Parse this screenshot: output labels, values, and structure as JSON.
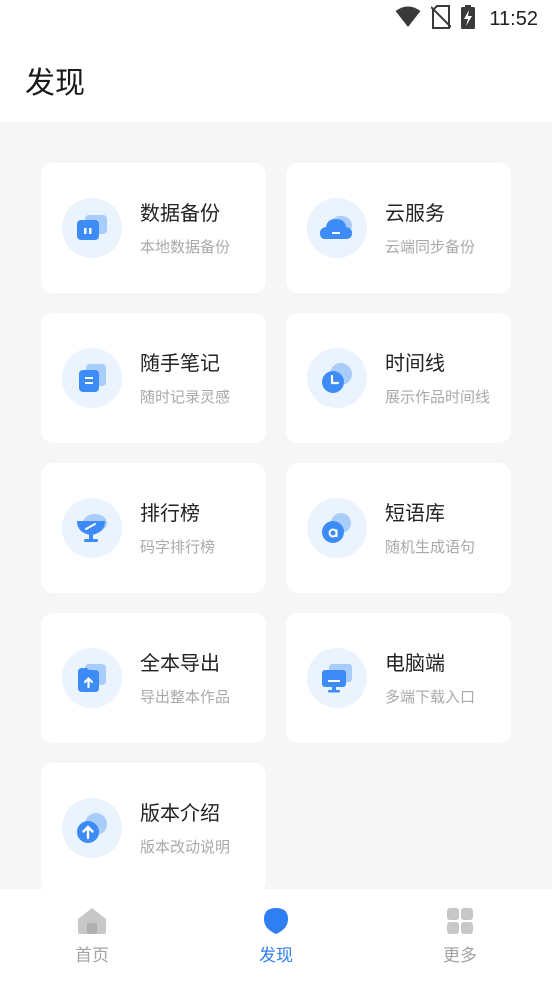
{
  "status_bar": {
    "time": "11:52",
    "icons": [
      "wifi-icon",
      "no-sim-icon",
      "battery-charging-icon"
    ]
  },
  "header": {
    "title": "发现"
  },
  "features": [
    {
      "title": "数据备份",
      "subtitle": "本地数据备份",
      "icon": "local-backup-icon"
    },
    {
      "title": "云服务",
      "subtitle": "云端同步备份",
      "icon": "cloud-icon"
    },
    {
      "title": "随手笔记",
      "subtitle": "随时记录灵感",
      "icon": "note-icon"
    },
    {
      "title": "时间线",
      "subtitle": "展示作品时间线",
      "icon": "clock-icon"
    },
    {
      "title": "排行榜",
      "subtitle": "码字排行榜",
      "icon": "trophy-icon"
    },
    {
      "title": "短语库",
      "subtitle": "随机生成语句",
      "icon": "phrase-icon"
    },
    {
      "title": "全本导出",
      "subtitle": "导出整本作品",
      "icon": "export-icon"
    },
    {
      "title": "电脑端",
      "subtitle": "多端下载入口",
      "icon": "desktop-icon"
    },
    {
      "title": "版本介绍",
      "subtitle": "版本改动说明",
      "icon": "version-icon"
    }
  ],
  "bottom_nav": [
    {
      "label": "首页",
      "icon": "home-icon",
      "active": false
    },
    {
      "label": "发现",
      "icon": "discover-icon",
      "active": true
    },
    {
      "label": "更多",
      "icon": "grid-icon",
      "active": false
    }
  ],
  "colors": {
    "accent": "#2f7ff3",
    "icon_bg": "#eaf3fe",
    "page_bg": "#f6f6f6",
    "inactive": "#a3a3a3"
  }
}
